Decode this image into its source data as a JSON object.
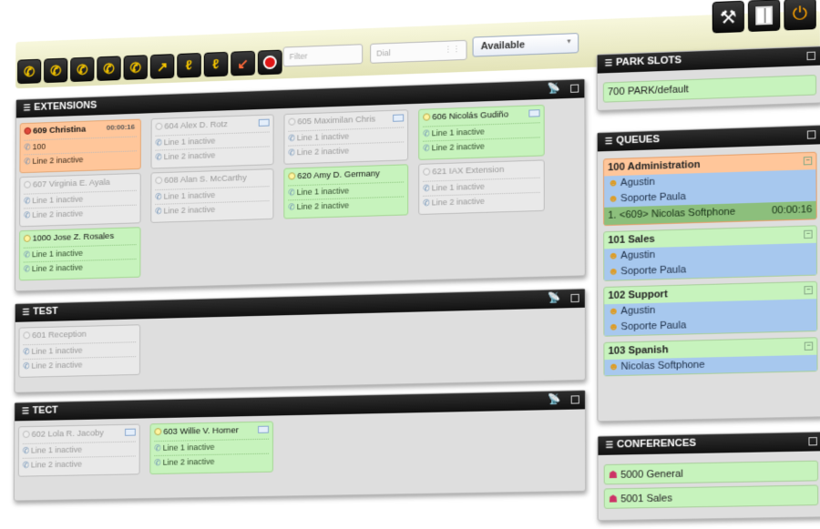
{
  "toolbar": {
    "buttons": [
      {
        "name": "dial-button",
        "glyph": "✆"
      },
      {
        "name": "transfer-button",
        "glyph": "✆"
      },
      {
        "name": "attended-transfer-button",
        "glyph": "✆"
      },
      {
        "name": "conference-button",
        "glyph": "✆"
      },
      {
        "name": "record-button",
        "glyph": "✆"
      },
      {
        "name": "pickup-button",
        "glyph": "↗"
      },
      {
        "name": "spy-button",
        "glyph": "ℓ"
      },
      {
        "name": "whisper-button",
        "glyph": "ℓ"
      },
      {
        "name": "hangup-button",
        "glyph": "↙"
      },
      {
        "name": "stop-button",
        "glyph": ""
      }
    ],
    "filter_placeholder": "Filter",
    "dial_placeholder": "Dial",
    "status_value": "Available"
  },
  "extensions_panel": {
    "title": "EXTENSIONS",
    "cards": [
      {
        "name": "609 Christina",
        "color": "orange",
        "status": "red",
        "line1": "100",
        "timer": "00:00:16",
        "line2": "Line 2 inactive",
        "mail": false
      },
      {
        "name": "604 Alex D. Rotz",
        "color": "grey",
        "status": "off",
        "line1": "Line 1 inactive",
        "line2": "Line 2 inactive",
        "mail": true
      },
      {
        "name": "605 Maximilan Chris",
        "color": "grey",
        "status": "off",
        "line1": "Line 1 inactive",
        "line2": "Line 2 inactive",
        "mail": true
      },
      {
        "name": "606 Nicolás Gudiño",
        "color": "green",
        "status": "on",
        "line1": "Line 1 inactive",
        "line2": "Line 2 inactive",
        "mail": true
      },
      {
        "name": "607 Virginia E. Ayala",
        "color": "grey",
        "status": "off",
        "line1": "Line 1 inactive",
        "line2": "Line 2 inactive",
        "mail": false
      },
      {
        "name": "608 Alan S. McCarthy",
        "color": "grey",
        "status": "off",
        "line1": "Line 1 inactive",
        "line2": "Line 2 inactive",
        "mail": false
      },
      {
        "name": "620 Amy D. Germany",
        "color": "green",
        "status": "on",
        "line1": "Line 1 inactive",
        "line2": "Line 2 inactive",
        "mail": false
      },
      {
        "name": "621 IAX Extension",
        "color": "grey",
        "status": "off",
        "line1": "Line 1 inactive",
        "line2": "Line 2 inactive",
        "mail": false
      },
      {
        "name": "1000 Jose Z. Rosales",
        "color": "green",
        "status": "on",
        "line1": "Line 1 inactive",
        "line2": "Line 2 inactive",
        "mail": false
      }
    ]
  },
  "test_panel": {
    "title": "TEST",
    "cards": [
      {
        "name": "601 Reception",
        "color": "grey",
        "status": "off",
        "line1": "Line 1 inactive",
        "line2": "Line 2 inactive",
        "mail": false
      }
    ]
  },
  "tect_panel": {
    "title": "TECT",
    "cards": [
      {
        "name": "602 Lola R. Jacoby",
        "color": "grey",
        "status": "off",
        "line1": "Line 1 inactive",
        "line2": "Line 2 inactive",
        "mail": true
      },
      {
        "name": "603 Willie V. Horner",
        "color": "green",
        "status": "on",
        "line1": "Line 1 inactive",
        "line2": "Line 2 inactive",
        "mail": true
      }
    ]
  },
  "park_slots": {
    "title": "PARK SLOTS",
    "items": [
      "700 PARK/default"
    ]
  },
  "queues": {
    "title": "QUEUES",
    "items": [
      {
        "title": "100 Administration",
        "active": true,
        "agents": [
          "Agustin",
          "Soporte Paula"
        ],
        "waiting": {
          "caller": "1. <609> Nicolas Softphone",
          "time": "00:00:16"
        }
      },
      {
        "title": "101 Sales",
        "active": false,
        "agents": [
          "Agustin",
          "Soporte Paula"
        ]
      },
      {
        "title": "102 Support",
        "active": false,
        "agents": [
          "Agustin",
          "Soporte Paula"
        ]
      },
      {
        "title": "103 Spanish",
        "active": false,
        "agents": [
          "Nicolas Softphone"
        ]
      }
    ]
  },
  "conferences": {
    "title": "CONFERENCES",
    "items": [
      "5000 General",
      "5001 Sales"
    ]
  }
}
